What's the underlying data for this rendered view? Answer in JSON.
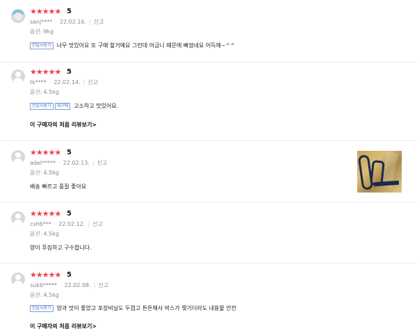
{
  "reviews": [
    {
      "stars": "★★★★★",
      "score": "5",
      "user": "sanj****",
      "date": "22.02.16.",
      "report": "신고",
      "option_label": "옵션:",
      "option_value": "9kg",
      "tags": [
        "한달사용기"
      ],
      "text": "너무 맛있어요 또 구매 할거예요 그런데 어금니 때문에 빠졌네요 어득해~^^"
    },
    {
      "stars": "★★★★★",
      "score": "5",
      "user": "tk****",
      "date": "22.02.14.",
      "report": "신고",
      "option_label": "옵션:",
      "option_value": "4.5kg",
      "tags": [
        "한달사용기",
        "재구매"
      ],
      "text": "고소하고 맛있어요.",
      "first_review_link": "이 구매자의 처음 리뷰보기",
      "chevron": ">"
    },
    {
      "stars": "★★★★★",
      "score": "5",
      "user": "adel*****",
      "date": "22.02.13.",
      "report": "신고",
      "option_label": "옵션:",
      "option_value": "4.5kg",
      "tags": [],
      "text": "배송 빠르고 품질 좋아요",
      "has_photo": true
    },
    {
      "stars": "★★★★★",
      "score": "5",
      "user": "csh6***",
      "date": "22.02.12.",
      "report": "신고",
      "option_label": "옵션:",
      "option_value": "4.5kg",
      "tags": [],
      "text": "양이 푸짐하고 구수합니다."
    },
    {
      "stars": "★★★★★",
      "score": "5",
      "user": "suk6*****",
      "date": "22.02.08.",
      "report": "신고",
      "option_label": "옵션:",
      "option_value": "4.5kg",
      "tags": [
        "한달사용기"
      ],
      "text": "양과 맛이 좋았고 포장비닐도 두껍고 튼튼해서 박스가 찢기더라도 내용물 안전",
      "first_review_link": "이 구매자의 처음 리뷰보기",
      "chevron": ">"
    }
  ],
  "icons": {
    "star": "star-icon",
    "avatar": "user-avatar-icon",
    "chevron": "chevron-right-icon"
  },
  "colors": {
    "star": "#f1404b",
    "tag_border": "#7b9bd6",
    "divider": "#ececec"
  }
}
